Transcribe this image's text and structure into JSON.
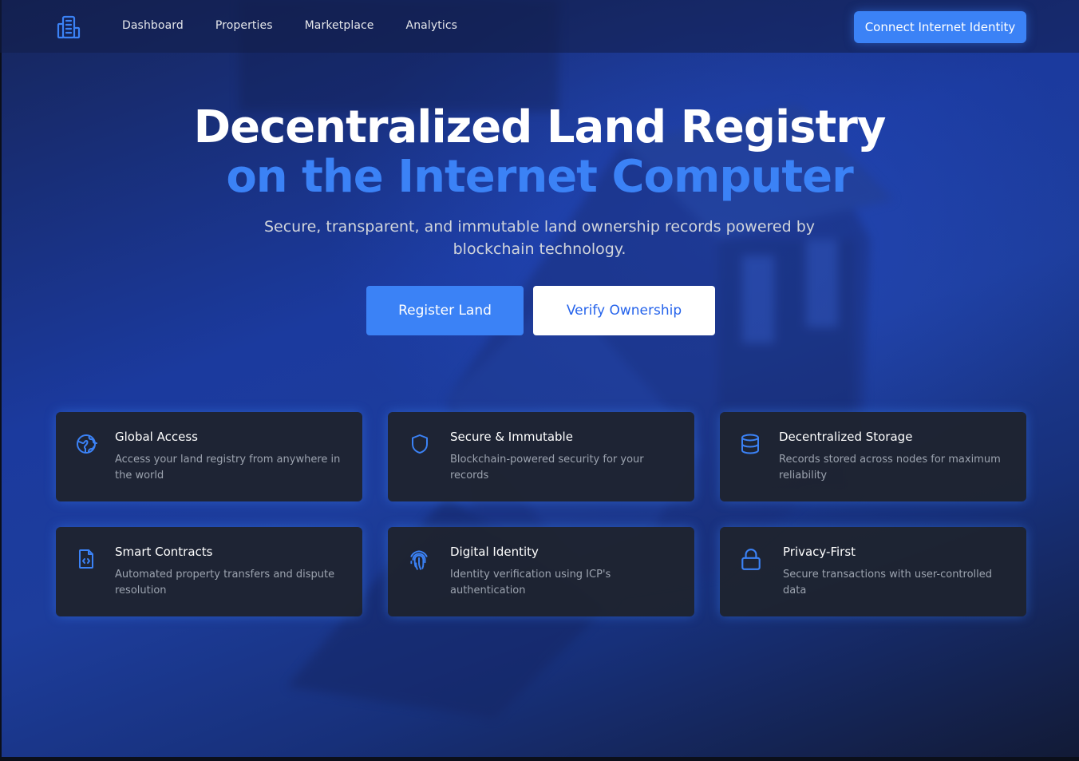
{
  "header": {
    "logo_icon": "building-icon",
    "nav": [
      {
        "label": "Dashboard"
      },
      {
        "label": "Properties"
      },
      {
        "label": "Marketplace"
      },
      {
        "label": "Analytics"
      }
    ],
    "connect_label": "Connect Internet Identity"
  },
  "hero": {
    "title": "Decentralized Land Registry",
    "subtitle": "on the Internet Computer",
    "description": "Secure, transparent, and immutable land ownership records powered by blockchain technology.",
    "primary_label": "Register Land",
    "secondary_label": "Verify Ownership"
  },
  "features": [
    {
      "icon": "globe-icon",
      "title": "Global Access",
      "description": "Access your land registry from anywhere in the world"
    },
    {
      "icon": "shield-icon",
      "title": "Secure & Immutable",
      "description": "Blockchain-powered security for your records"
    },
    {
      "icon": "database-icon",
      "title": "Decentralized Storage",
      "description": "Records stored across nodes for maximum reliability"
    },
    {
      "icon": "code-file-icon",
      "title": "Smart Contracts",
      "description": "Automated property transfers and dispute resolution"
    },
    {
      "icon": "fingerprint-icon",
      "title": "Digital Identity",
      "description": "Identity verification using ICP's authentication"
    },
    {
      "icon": "lock-icon",
      "title": "Privacy-First",
      "description": "Secure transactions with user-controlled data"
    }
  ],
  "colors": {
    "accent": "#3b82f6",
    "card_bg": "#1e2330",
    "title_text": "#ffffff",
    "muted_text": "#9ca3af"
  }
}
